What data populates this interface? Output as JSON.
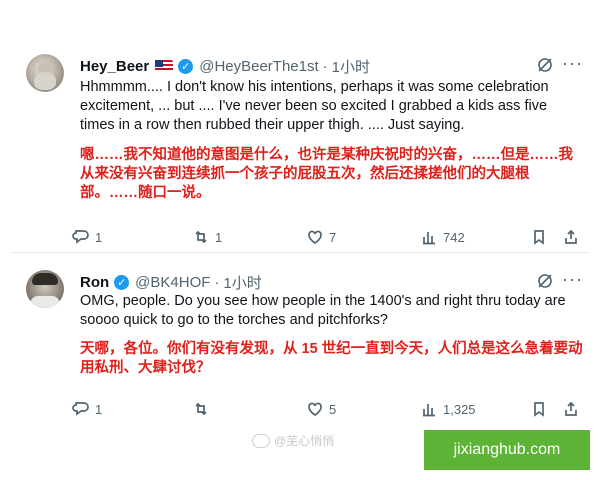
{
  "tweets": [
    {
      "name": "Hey_Beer",
      "handle": "@HeyBeerThe1st",
      "separator": "·",
      "time": "1小时",
      "text_en": "Hhmmmm.... I don't know his intentions, perhaps it was some celebration excitement, ... but .... I've never been so excited I grabbed a kids ass five times in a row then rubbed their upper thigh. .... Just saying.",
      "text_zh": "嗯……我不知道他的意图是什么，也许是某种庆祝时的兴奋，……但是……我从来没有兴奋到连续抓一个孩子的屁股五次，然后还揉搓他们的大腿根部。……随口一说。",
      "replies": "1",
      "reposts": "1",
      "likes": "7",
      "views": "742"
    },
    {
      "name": "Ron",
      "handle": "@BK4HOF",
      "separator": "·",
      "time": "1小时",
      "text_en": "OMG, people. Do you see how people in the 1400's and right thru today are soooo quick to go to the torches and pitchforks?",
      "text_zh": "天哪，各位。你们有没有发现，从 15 世纪一直到今天，人们总是这么急着要动用私刑、大肆讨伐？",
      "replies": "1",
      "reposts": "",
      "likes": "5",
      "views": "1,325"
    }
  ],
  "watermark_text": "@芜心悄悄",
  "site_label": "jixianghub.com",
  "colors": {
    "accent": "#1d9bf0",
    "translation": "#e0201b",
    "muted": "#536471",
    "site_bg": "#5cb336"
  },
  "icons": [
    "verified-badge-icon",
    "us-flag-icon",
    "grok-icon",
    "more-icon",
    "reply-icon",
    "repost-icon",
    "like-icon",
    "views-icon",
    "bookmark-icon",
    "share-icon"
  ]
}
